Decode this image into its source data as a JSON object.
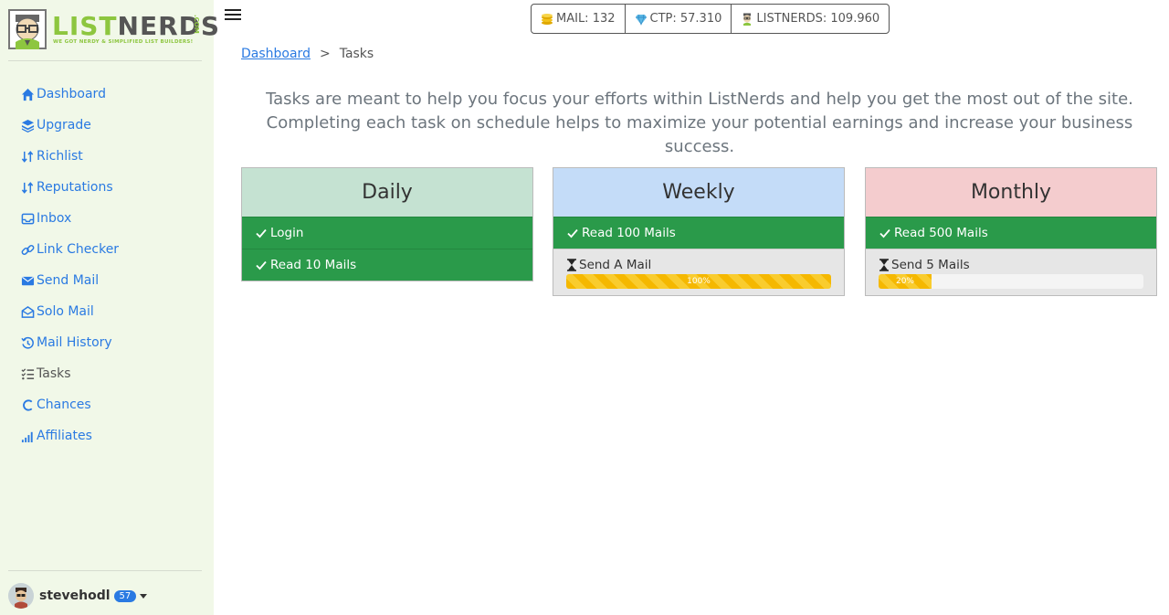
{
  "logo": {
    "part1": "LIST",
    "part2": "NERDS",
    "tagline": "WE GOT NERDY & SIMPLIFIED LIST BUILDERS!",
    "domain": ".COM"
  },
  "sidebar": {
    "items": [
      {
        "label": "Dashboard",
        "icon": "home-icon"
      },
      {
        "label": "Upgrade",
        "icon": "layers-icon"
      },
      {
        "label": "Richlist",
        "icon": "sort-icon"
      },
      {
        "label": "Reputations",
        "icon": "sort-icon"
      },
      {
        "label": "Inbox",
        "icon": "inbox-icon"
      },
      {
        "label": "Link Checker",
        "icon": "link-icon"
      },
      {
        "label": "Send Mail",
        "icon": "envelope-icon"
      },
      {
        "label": "Solo Mail",
        "icon": "envelope-open-icon"
      },
      {
        "label": "Mail History",
        "icon": "history-icon"
      },
      {
        "label": "Tasks",
        "icon": "list-check-icon"
      },
      {
        "label": "Chances",
        "icon": "c-icon"
      },
      {
        "label": "Affiliates",
        "icon": "signal-icon"
      }
    ]
  },
  "user": {
    "name": "stevehodl",
    "level": "57"
  },
  "stats": {
    "mail": "MAIL: 132",
    "ctp": "CTP: 57.310",
    "listnerds": "LISTNERDS: 109.960"
  },
  "breadcrumb": {
    "home": "Dashboard",
    "separator": ">",
    "current": "Tasks"
  },
  "intro": "Tasks are meant to help you focus your efforts within ListNerds and help you get the most out of the site. Completing each task on schedule helps to maximize your potential earnings and increase your business success.",
  "cards": {
    "daily": {
      "title": "Daily",
      "header_color": "#c5e2d2",
      "done": [
        "Login",
        "Read 10 Mails"
      ]
    },
    "weekly": {
      "title": "Weekly",
      "header_color": "#c4dcf8",
      "done": [
        "Read 100 Mails"
      ],
      "pending": {
        "label": "Send A Mail",
        "progress_label": "100%",
        "progress": 1.0
      }
    },
    "monthly": {
      "title": "Monthly",
      "header_color": "#f4ccce",
      "done": [
        "Read 500 Mails"
      ],
      "pending": {
        "label": "Send 5 Mails",
        "progress_label": "20%",
        "progress": 0.2
      }
    }
  },
  "colors": {
    "done_row": "#2a9a4a",
    "progress": "#f5b800",
    "link": "#2a7ae2"
  }
}
